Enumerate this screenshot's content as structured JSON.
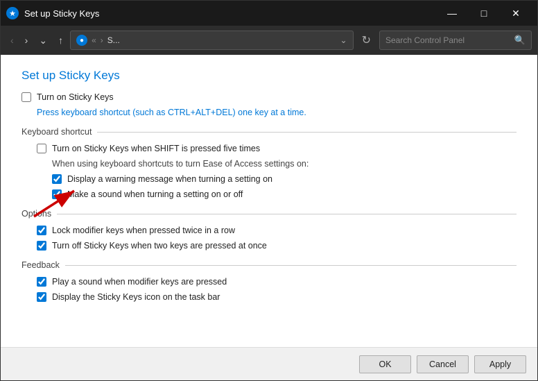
{
  "window": {
    "title": "Set up Sticky Keys",
    "icon": "★"
  },
  "titlebar": {
    "minimize_label": "—",
    "maximize_label": "□",
    "close_label": "✕"
  },
  "navbar": {
    "back_label": "‹",
    "forward_label": "›",
    "dropdown_label": "⌄",
    "up_label": "↑",
    "address_icon": "●",
    "address_text": "S...",
    "refresh_label": "↻",
    "search_placeholder": "Search Control Panel",
    "search_icon": "🔍"
  },
  "content": {
    "page_title": "Set up Sticky Keys",
    "turn_on_label": "Turn on Sticky Keys",
    "hint_text": "Press keyboard shortcut (such as CTRL+ALT+DEL) one key at a time.",
    "sections": [
      {
        "id": "keyboard-shortcut",
        "label": "Keyboard shortcut",
        "items": [
          {
            "id": "shift-shortcut",
            "label": "Turn on Sticky Keys when SHIFT is pressed five times",
            "checked": false,
            "indented": 1
          }
        ],
        "sub_label": "When using keyboard shortcuts to turn Ease of Access settings on:",
        "sub_items": [
          {
            "id": "warning-message",
            "label": "Display a warning message when turning a setting on",
            "checked": true,
            "indented": 2
          },
          {
            "id": "sound-setting",
            "label": "Make a sound when turning a setting on or off",
            "checked": true,
            "indented": 2
          }
        ]
      },
      {
        "id": "options",
        "label": "Options",
        "items": [
          {
            "id": "lock-modifier",
            "label": "Lock modifier keys when pressed twice in a row",
            "checked": true,
            "indented": 1
          },
          {
            "id": "turn-off-two-keys",
            "label": "Turn off Sticky Keys when two keys are pressed at once",
            "checked": true,
            "indented": 1
          }
        ]
      },
      {
        "id": "feedback",
        "label": "Feedback",
        "items": [
          {
            "id": "play-sound",
            "label": "Play a sound when modifier keys are pressed",
            "checked": true,
            "indented": 1
          },
          {
            "id": "display-icon",
            "label": "Display the Sticky Keys icon on the task bar",
            "checked": true,
            "indented": 1
          }
        ]
      }
    ]
  },
  "footer": {
    "ok_label": "OK",
    "cancel_label": "Cancel",
    "apply_label": "Apply"
  }
}
